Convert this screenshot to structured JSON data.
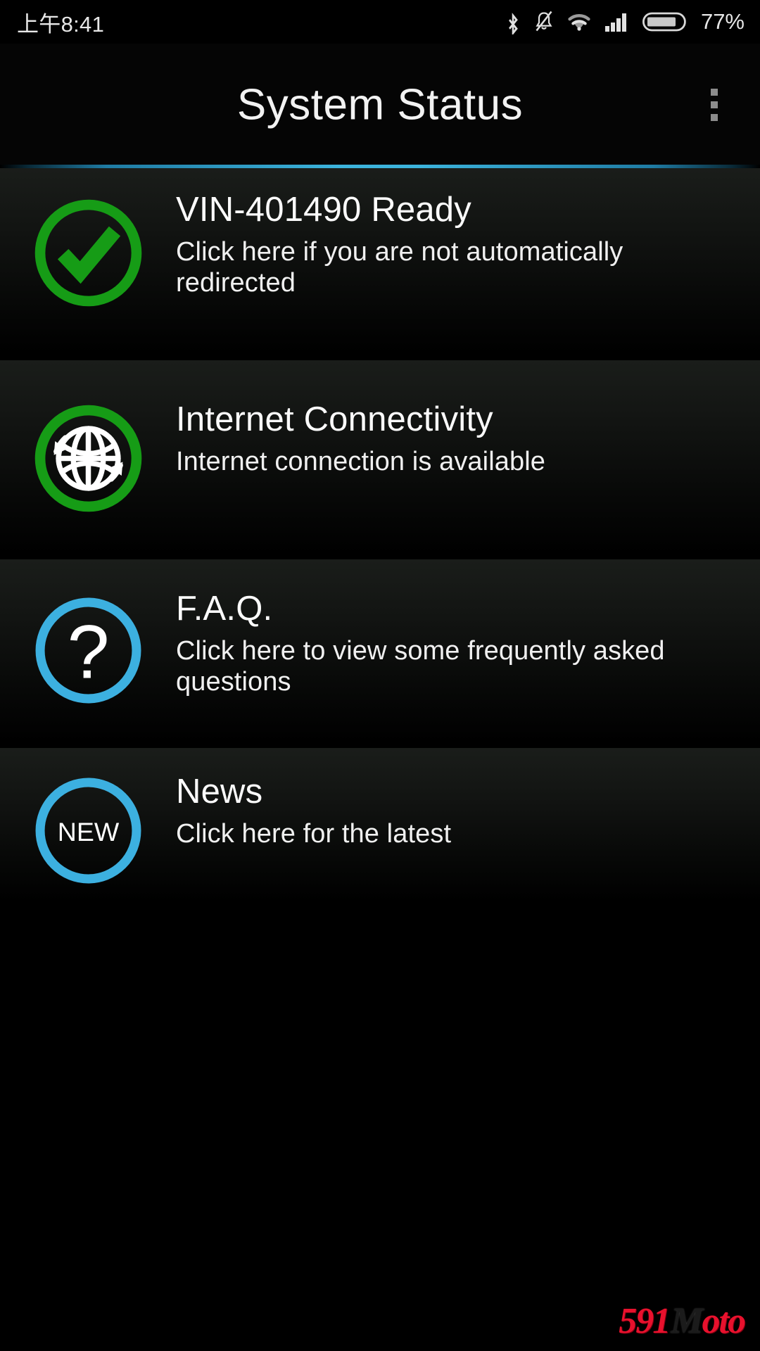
{
  "status_bar": {
    "clock": "上午8:41",
    "battery_percent": "77%",
    "icons": [
      "bluetooth-icon",
      "bell-muted-icon",
      "wifi-icon",
      "cellular-signal-icon",
      "battery-icon"
    ]
  },
  "action_bar": {
    "title": "System Status",
    "overflow_label": "overflow-menu"
  },
  "list": {
    "items": [
      {
        "icon": "check-circle-icon",
        "icon_color": "#169c16",
        "title": "VIN-401490 Ready",
        "subtitle": "Click here if you are not automatically redirected"
      },
      {
        "icon": "globe-refresh-icon",
        "icon_color": "#169c16",
        "title": "Internet Connectivity",
        "subtitle": "Internet connection is available"
      },
      {
        "icon": "question-circle-icon",
        "icon_color": "#3cb0e0",
        "title": "F.A.Q.",
        "subtitle": "Click here to view some frequently asked questions"
      },
      {
        "icon": "new-badge-icon",
        "icon_color": "#3cb0e0",
        "icon_text": "NEW",
        "title": "News",
        "subtitle": "Click here for the latest"
      }
    ]
  },
  "watermark": {
    "number": "591",
    "m": "M",
    "oto": "oto"
  },
  "colors": {
    "accent_blue": "#3cb4dd",
    "status_green": "#169c16",
    "info_blue": "#3cb0e0",
    "background": "#000000",
    "row_top": "#1a1d1a",
    "text_primary": "#fbfbfb"
  }
}
